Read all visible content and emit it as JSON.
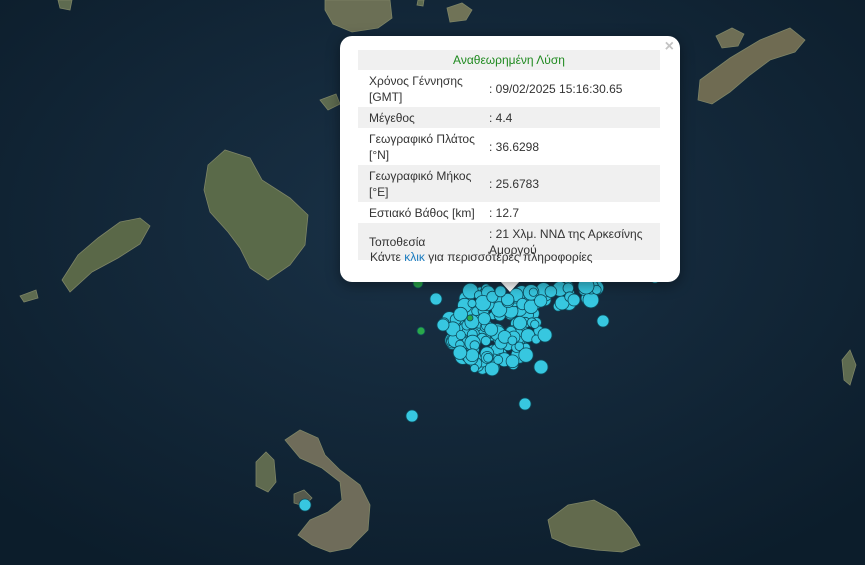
{
  "popup": {
    "title": "Αναθεωρημένη Λύση",
    "rows": [
      {
        "label": "Χρόνος Γέννησης [GMT]",
        "value": ": 09/02/2025 15:16:30.65"
      },
      {
        "label": "Μέγεθος",
        "value": ": 4.4"
      },
      {
        "label": "Γεωγραφικό Πλάτος [°N]",
        "value": ": 36.6298"
      },
      {
        "label": "Γεωγραφικό Μήκος [°E]",
        "value": ": 25.6783"
      },
      {
        "label": "Εστιακό Βάθος [km]",
        "value": ": 12.7"
      },
      {
        "label": "Τοποθεσία",
        "value": ": 21 Χλμ. ΝΝΔ της Αρκεσίνης Αμοργού"
      }
    ],
    "footer_prefix": "Κάντε",
    "footer_link": "κλικ",
    "footer_suffix": "για περισσότερες πληροφορίες",
    "close_label": "×"
  },
  "colors": {
    "sea": "#13283a",
    "land": "#5b6a4e",
    "quake_marker": "#37c7e0",
    "recent_quake_marker": "#2aa84a",
    "accent_title": "#1f8a1f",
    "link": "#1a7bbf"
  }
}
